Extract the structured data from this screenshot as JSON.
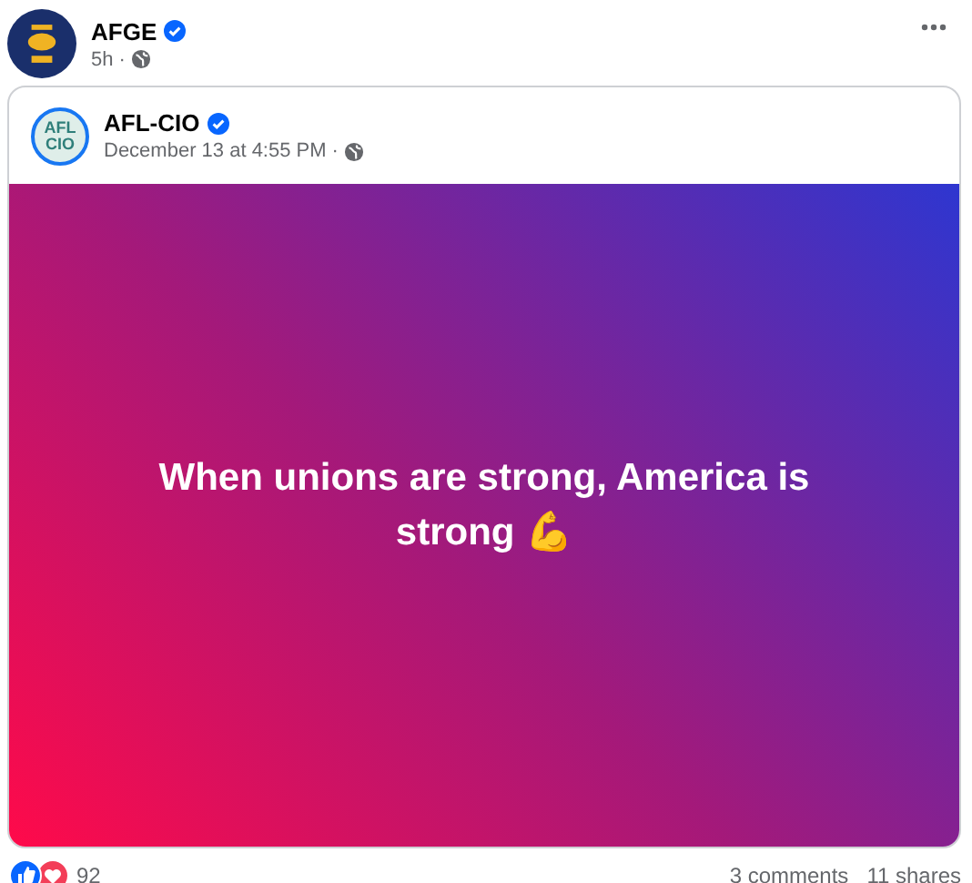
{
  "post": {
    "author": "AFGE",
    "verified": true,
    "time": "5h",
    "separator": "·"
  },
  "shared_post": {
    "author": "AFL-CIO",
    "verified": true,
    "logo_text": [
      "AFL",
      "CIO"
    ],
    "time": "December 13 at 4:55 PM",
    "separator": "·",
    "text": "When unions are strong, America is strong 💪"
  },
  "reactions": {
    "count": "92"
  },
  "comments": "3 comments",
  "shares": "11 shares"
}
